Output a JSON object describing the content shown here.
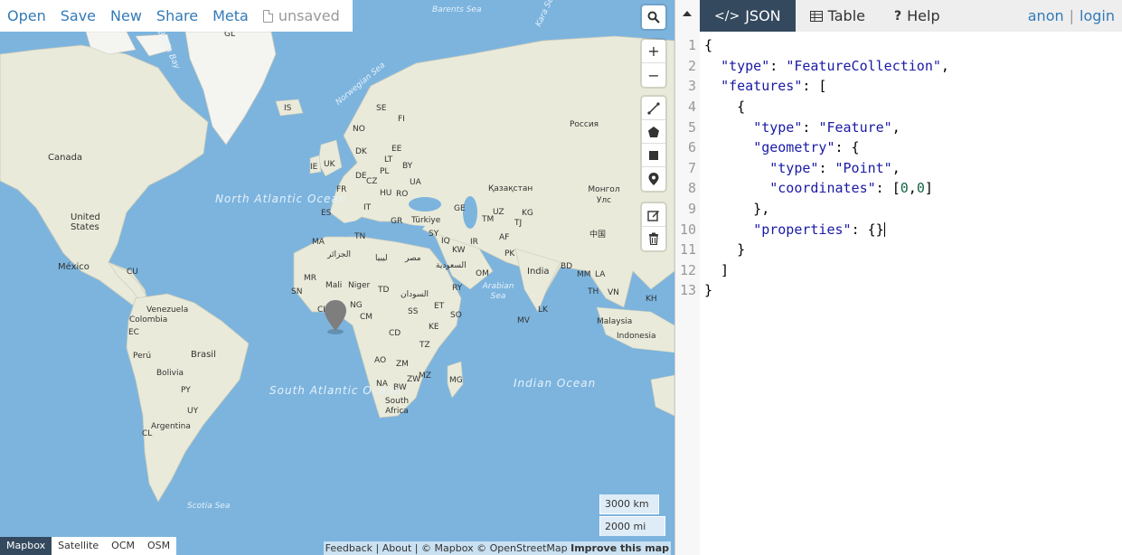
{
  "menu": {
    "open": "Open",
    "save": "Save",
    "new": "New",
    "share": "Share",
    "meta": "Meta",
    "unsaved": "unsaved"
  },
  "map_labels": {
    "greenland": "GL",
    "barents_sea": "Barents Sea",
    "kara_sea": "Kara Sea",
    "baffin_bay": "Baffin Bay",
    "norwegian_sea": "Norwegian Sea",
    "iceland": "IS",
    "sweden": "SE",
    "finland": "FI",
    "norway": "NO",
    "russia": "Россия",
    "canada": "Canada",
    "ireland": "IE",
    "uk": "UK",
    "denmark": "DK",
    "estonia": "EE",
    "lithuania": "LT",
    "belarus": "BY",
    "poland": "PL",
    "germany": "DE",
    "czech": "CZ",
    "ukraine": "UA",
    "hungary": "HU",
    "france": "FR",
    "romania": "RO",
    "kazakhstan": "Қазақстан",
    "mongolia": "Монгол Улс",
    "north_atlantic": "North Atlantic Ocean",
    "spain": "ES",
    "italy": "IT",
    "greece": "GR",
    "turkey": "Türkiye",
    "georgia": "GE",
    "uzbekistan": "UZ",
    "kyrgyzstan": "KG",
    "usa": "United States",
    "turkmenistan": "TM",
    "tajikistan": "TJ",
    "tunisia": "TN",
    "syria": "SY",
    "morocco": "MA",
    "iraq": "IQ",
    "iran": "IR",
    "afghanistan": "AF",
    "china": "中国",
    "algeria": "الجزائر",
    "libya": "ليبيا",
    "egypt": "مصر",
    "kuwait": "KW",
    "pakistan": "PK",
    "mexico": "México",
    "cuba": "CU",
    "saudi": "السعودية",
    "oman": "OM",
    "india": "India",
    "bangladesh": "BD",
    "myanmar": "MM",
    "laos": "LA",
    "mauritania": "MR",
    "mali": "Mali",
    "niger": "Niger",
    "chad": "TD",
    "sudan": "السودان",
    "yemen": "RY",
    "arabian_sea": "Arabian Sea",
    "thailand": "TH",
    "vietnam": "VN",
    "senegal": "SN",
    "venezuela": "Venezuela",
    "cambodia": "KH",
    "colombia": "Colombia",
    "ivory_coast": "CI",
    "nigeria": "NG",
    "south_sudan": "SS",
    "ethiopia": "ET",
    "somalia": "SO",
    "cameroon": "CM",
    "sri_lanka": "LK",
    "maldives": "MV",
    "malaysia": "Malaysia",
    "ecuador": "EC",
    "kenya": "KE",
    "drc": "CD",
    "indonesia": "Indonesia",
    "peru": "Perú",
    "brasil": "Brasil",
    "tanzania": "TZ",
    "angola": "AO",
    "zambia": "ZM",
    "bolivia": "Bolivia",
    "indian_ocean": "Indian Ocean",
    "madagascar": "MG",
    "zimbabwe": "ZW",
    "mozambique": "MZ",
    "namibia": "NA",
    "botswana": "BW",
    "paraguay": "PY",
    "south_atlantic": "South Atlantic Ocean",
    "south_africa": "South Africa",
    "uruguay": "UY",
    "argentina": "Argentina",
    "chile": "CL",
    "scotia_sea": "Scotia Sea"
  },
  "controls": {
    "zoom_in": "+",
    "zoom_out": "−"
  },
  "scale": {
    "km": "3000 km",
    "mi": "2000 mi"
  },
  "layers": [
    "Mapbox",
    "Satellite",
    "OCM",
    "OSM"
  ],
  "attribution": {
    "feedback": "Feedback",
    "about": "About",
    "mapbox": "© Mapbox",
    "osm": "© OpenStreetMap",
    "improve": "Improve this map"
  },
  "tabs": {
    "json": "JSON",
    "table": "Table",
    "help": "Help"
  },
  "user": {
    "name": "anon",
    "login": "login"
  },
  "code_lines": [
    "1",
    "2",
    "3",
    "4",
    "5",
    "6",
    "7",
    "8",
    "9",
    "10",
    "11",
    "12",
    "13"
  ],
  "colors": {
    "ocean": "#7cb4de",
    "land": "#e9ead9",
    "accent": "#337ab7",
    "active_tab": "#34495e"
  }
}
